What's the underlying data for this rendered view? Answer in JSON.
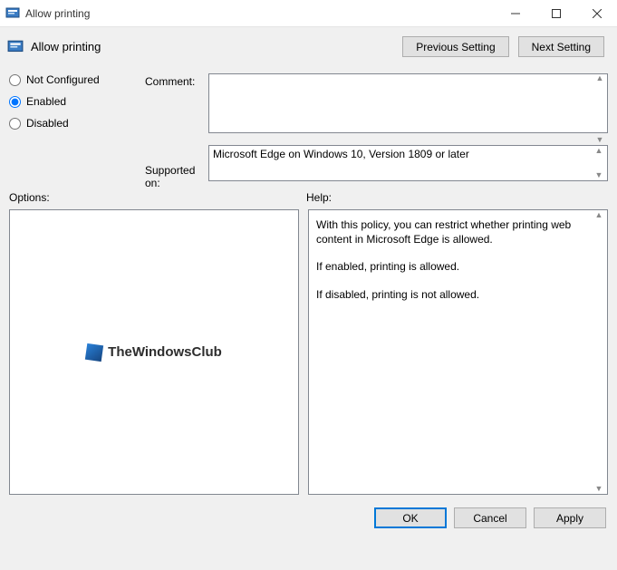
{
  "window": {
    "title": "Allow printing"
  },
  "header": {
    "title": "Allow printing",
    "previous": "Previous Setting",
    "next": "Next Setting"
  },
  "state": {
    "not_configured": "Not Configured",
    "enabled": "Enabled",
    "disabled": "Disabled",
    "selected": "enabled"
  },
  "fields": {
    "comment_label": "Comment:",
    "comment_value": "",
    "supported_label": "Supported on:",
    "supported_value": "Microsoft Edge on Windows 10, Version 1809 or later"
  },
  "sections": {
    "options": "Options:",
    "help": "Help:"
  },
  "help": {
    "p1": "With this policy, you can restrict whether printing web content in Microsoft Edge is allowed.",
    "p2": "If enabled, printing is allowed.",
    "p3": "If disabled, printing is not allowed."
  },
  "watermark": "TheWindowsClub",
  "buttons": {
    "ok": "OK",
    "cancel": "Cancel",
    "apply": "Apply"
  }
}
